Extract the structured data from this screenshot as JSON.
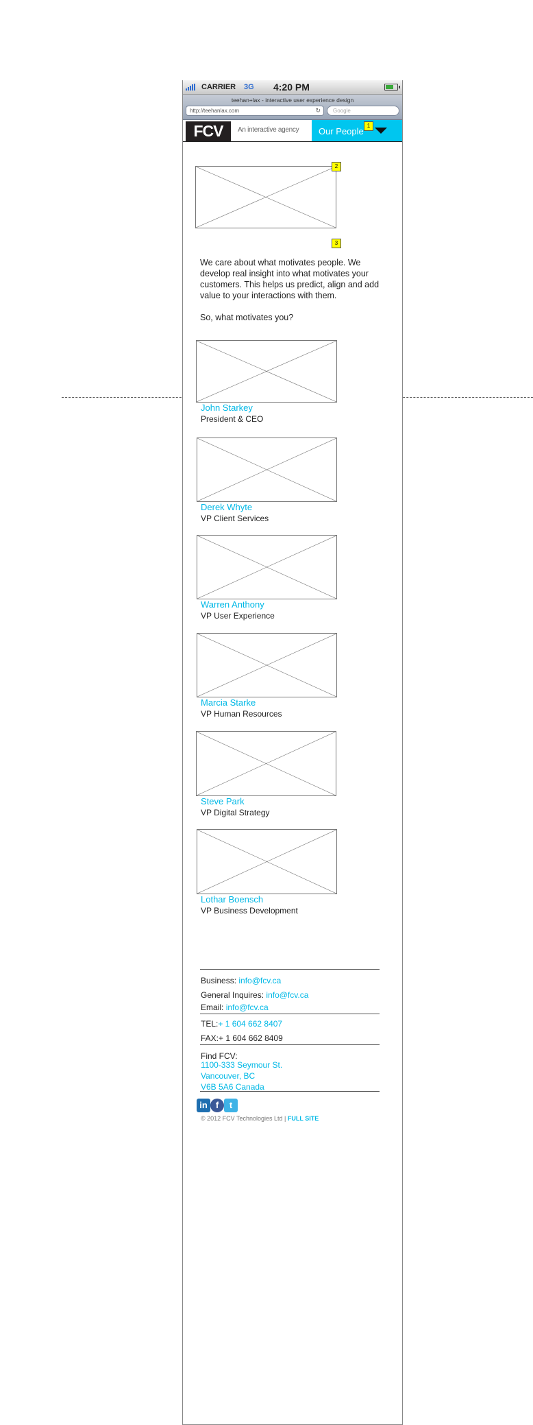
{
  "status_bar": {
    "carrier": "CARRIER",
    "network": "3G",
    "time": "4:20 PM"
  },
  "browser": {
    "page_title": "teehan+lax - interactive user experience design",
    "url": "http://teehanlax.com",
    "search_placeholder": "Google"
  },
  "header": {
    "logo": "FCV",
    "tagline": "An interactive agency",
    "menu_label": "Our People"
  },
  "annotations": [
    "1",
    "2",
    "3"
  ],
  "intro": {
    "paragraph": "We care about what motivates people. We develop real insight into what motivates your customers. This helps us predict, align and add value to your interactions with them.",
    "question": "So, what motivates you?"
  },
  "people": [
    {
      "name": "John Starkey",
      "role": "President & CEO"
    },
    {
      "name": "Derek Whyte",
      "role": "VP Client Services"
    },
    {
      "name": "Warren Anthony",
      "role": "VP User Experience"
    },
    {
      "name": "Marcia Starke",
      "role": "VP Human Resources"
    },
    {
      "name": "Steve Park",
      "role": "VP Digital Strategy"
    },
    {
      "name": "Lothar Boensch",
      "role": "VP Business Development"
    }
  ],
  "footer": {
    "business_label": "Business:",
    "business_email": "info@fcv.ca",
    "general_label": "General Inquires:",
    "general_email": "info@fcv.ca",
    "email_label": "Email:",
    "email_value": "info@fcv.ca",
    "tel_label": "TEL:",
    "tel_value": "+ 1 604 662 8407",
    "fax_text": "FAX:+ 1 604 662 8409",
    "find_label": "Find FCV:",
    "address": [
      "1100-333 Seymour St.",
      "Vancouver, BC",
      "V6B 5A6 Canada"
    ],
    "social_icons": [
      "linkedin-icon",
      "facebook-icon",
      "twitter-icon"
    ],
    "social_glyphs": [
      "in",
      "f",
      "t"
    ],
    "copyright": "© 2012 FCV Technologies Ltd |",
    "full_site": "FULL SITE"
  },
  "colors": {
    "accent": "#00c6ef",
    "logo_bg": "#231f20",
    "annotation": "#ffff00"
  }
}
